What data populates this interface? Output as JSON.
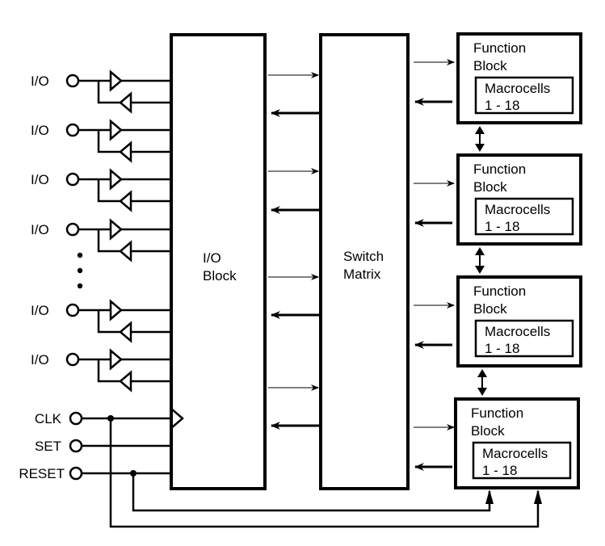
{
  "diagram": {
    "type": "block-diagram",
    "io_pins": [
      {
        "label": "I/O"
      },
      {
        "label": "I/O"
      },
      {
        "label": "I/O"
      },
      {
        "label": "I/O"
      },
      {
        "label": "I/O"
      },
      {
        "label": "I/O"
      }
    ],
    "ellipsis": "⋮",
    "control_pins": [
      {
        "label": "CLK"
      },
      {
        "label": "SET"
      },
      {
        "label": "RESET"
      }
    ],
    "io_block": {
      "line1": "I/O",
      "line2": "Block"
    },
    "switch_matrix": {
      "line1": "Switch",
      "line2": "Matrix"
    },
    "function_blocks": [
      {
        "line1": "Function",
        "line2": "Block",
        "macro_line1": "Macrocells",
        "macro_line2": "1 - 18"
      },
      {
        "line1": "Function",
        "line2": "Block",
        "macro_line1": "Macrocells",
        "macro_line2": "1 - 18"
      },
      {
        "line1": "Function",
        "line2": "Block",
        "macro_line1": "Macrocells",
        "macro_line2": "1 - 18"
      },
      {
        "line1": "Function",
        "line2": "Block",
        "macro_line1": "Macrocells",
        "macro_line2": "1 - 18"
      }
    ],
    "colors": {
      "line": "#000000",
      "forward_arrow": "#808080",
      "background": "#ffffff"
    }
  }
}
